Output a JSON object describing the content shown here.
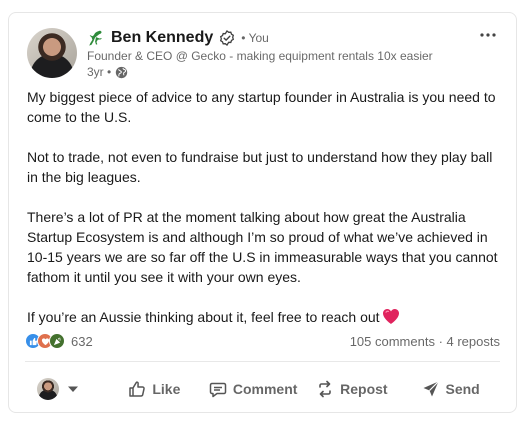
{
  "post": {
    "author": {
      "name": "Ben Kennedy",
      "you_label": "• You",
      "headline": "Founder & CEO @ Gecko - making equipment rentals 10x easier",
      "time": "3yr •"
    },
    "body": {
      "p1": "My biggest piece of advice to any startup founder in Australia is you need to come to the U.S.",
      "p2": "Not to trade, not even to fundraise but just to understand how they play ball in the big leagues.",
      "p3": "There’s a lot of PR at the moment talking about how great the Australia Startup Ecosystem is and although I’m so proud of what we’ve achieved in 10-15 years we are so far off the U.S in immeasurable ways that you cannot fathom it until you see it with your own eyes.",
      "p4": "If you’re an Aussie thinking about it, feel free to reach out"
    },
    "social": {
      "reaction_count": "632",
      "comments": "105 comments",
      "separator": " · ",
      "reposts": "4 reposts"
    },
    "actions": {
      "like": "Like",
      "comment": "Comment",
      "repost": "Repost",
      "send": "Send"
    }
  },
  "colors": {
    "like_blue": "#378fe9",
    "celebrate_green": "#44712e",
    "love_red": "#df704d",
    "heart": "#e0245e"
  }
}
